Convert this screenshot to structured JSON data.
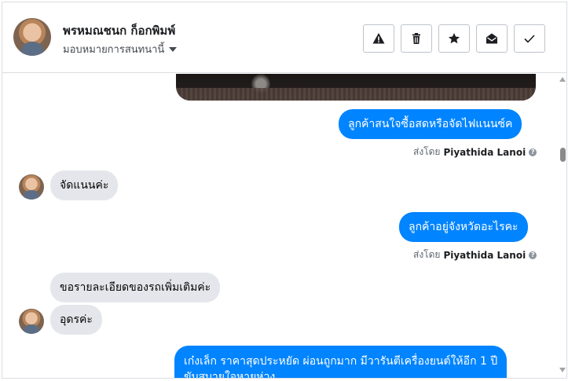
{
  "header": {
    "contact_name": "พรหมณชนก ก็อกพิมพ์",
    "assign_label": "มอบหมายการสนทนานี้",
    "actions": [
      {
        "name": "report-spam-button",
        "icon": "warning-icon"
      },
      {
        "name": "delete-button",
        "icon": "trash-icon"
      },
      {
        "name": "star-button",
        "icon": "star-icon"
      },
      {
        "name": "mark-unread-button",
        "icon": "envelope-open-icon"
      },
      {
        "name": "mark-done-button",
        "icon": "check-icon"
      }
    ]
  },
  "messages": [
    {
      "direction": "out",
      "text": "ลูกค้าสนใจซื้อสดหรือจัดไฟแนนซ์ค"
    },
    {
      "direction": "in",
      "text": "จัดแนนค่ะ"
    },
    {
      "direction": "out",
      "text": "ลูกค้าอยู่จังหวัดอะไรคะ"
    },
    {
      "direction": "in",
      "text": "ขอรายละเอียดของรถเพิ่มเติมค่ะ"
    },
    {
      "direction": "in",
      "text": "อุดรค่ะ"
    },
    {
      "direction": "out",
      "text": "เก๋งเล็ก ราคาสุดประหยัด ผ่อนถูกมาก มีวารันตีเครื่องยนต์ให้อีก 1 ปี",
      "text2": "ขับสบายใจหายห่วง"
    }
  ],
  "sent_by": {
    "prefix": "ส่งโดย",
    "agent": "Piyathida Lanoi",
    "info_icon": "info-icon"
  },
  "colors": {
    "outgoing_bubble": "#0084ff",
    "incoming_bubble": "#e4e6eb"
  }
}
